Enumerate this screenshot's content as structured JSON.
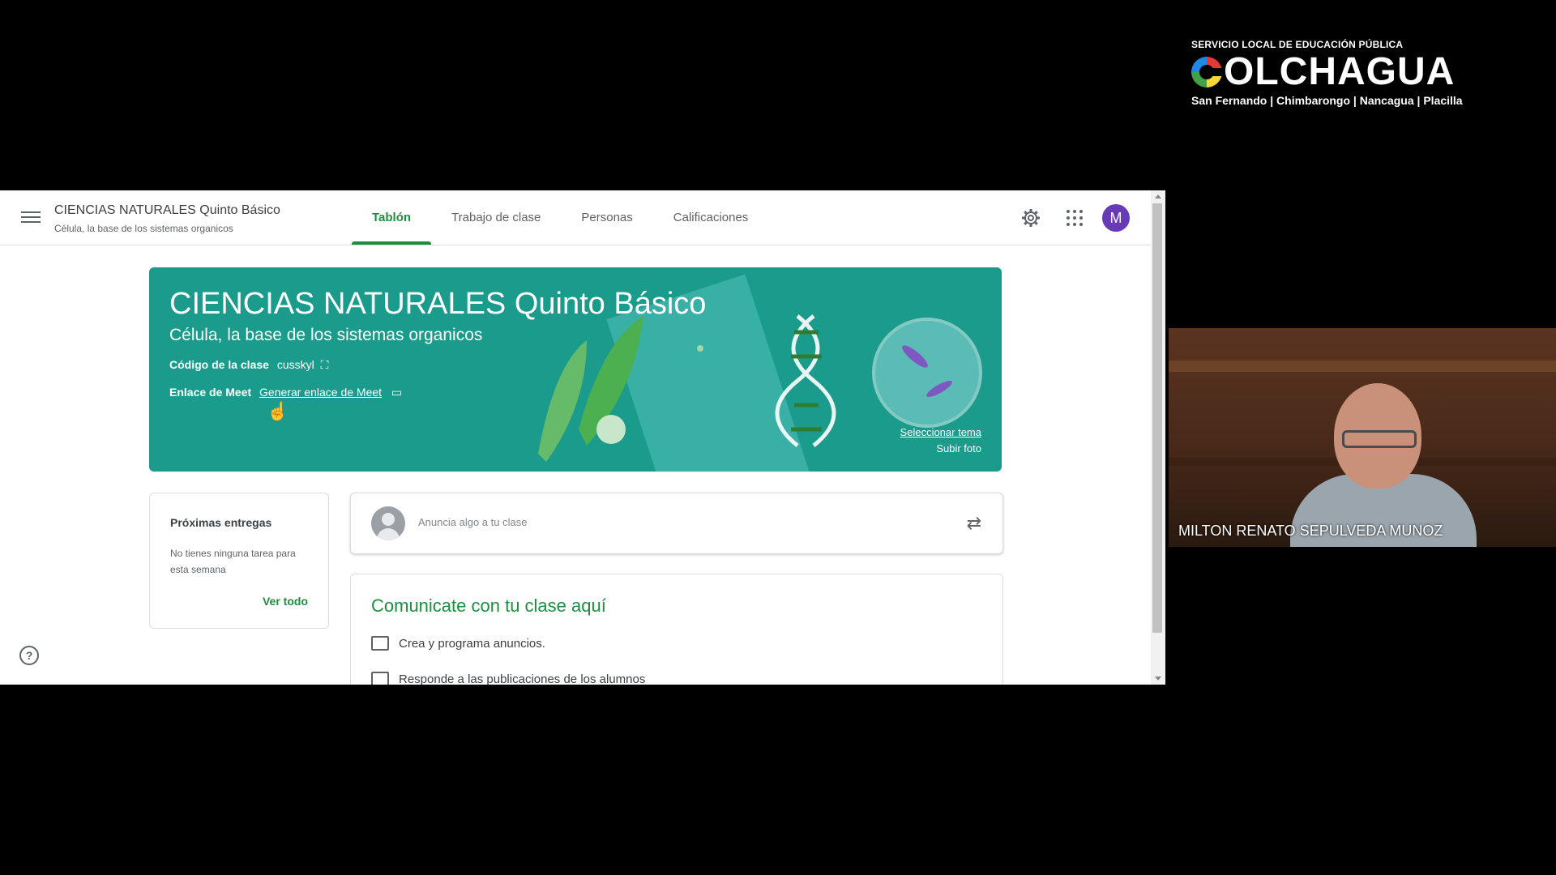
{
  "header": {
    "class_title": "CIENCIAS NATURALES Quinto Básico",
    "class_subtitle": "Célula, la base de los sistemas organicos",
    "tabs": [
      {
        "label": "Tablón",
        "active": true
      },
      {
        "label": "Trabajo de clase",
        "active": false
      },
      {
        "label": "Personas",
        "active": false
      },
      {
        "label": "Calificaciones",
        "active": false
      }
    ],
    "avatar_letter": "M",
    "icons": [
      "menu-icon",
      "gear-icon",
      "apps-grid-icon"
    ]
  },
  "banner": {
    "title": "CIENCIAS NATURALES Quinto Básico",
    "subtitle": "Célula, la base de los sistemas organicos",
    "code_label": "Código de la clase",
    "code_value": "cusskyl",
    "meet_label": "Enlace de Meet",
    "meet_link": "Generar enlace de Meet",
    "select_theme": "Seleccionar tema",
    "upload_photo": "Subir foto",
    "color": "#1a9b8c"
  },
  "upcoming": {
    "title": "Próximas entregas",
    "text": "No tienes ninguna tarea para esta semana",
    "link": "Ver todo"
  },
  "announce": {
    "placeholder": "Anuncia algo a tu clase"
  },
  "communicate": {
    "title": "Comunicate con tu clase aquí",
    "items": [
      "Crea y programa anuncios.",
      "Responde a las publicaciones de los alumnos"
    ]
  },
  "logo": {
    "top": "SERVICIO LOCAL DE EDUCACIÓN PÚBLICA",
    "main": "OLCHAGUA",
    "bottom": "San Fernando | Chimbarongo | Nancagua | Placilla"
  },
  "video": {
    "participant_name": "MILTON RENATO SEPULVEDA MUNOZ"
  },
  "colors": {
    "accent": "#1e8e3e",
    "avatar": "#673ab7"
  }
}
